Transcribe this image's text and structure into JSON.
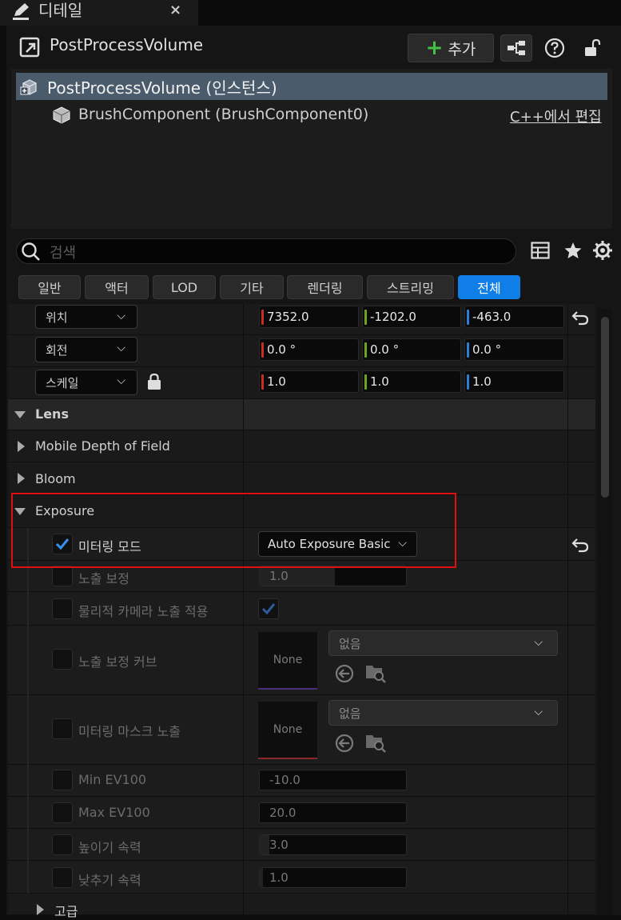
{
  "tab": {
    "title": "디테일",
    "close": "×"
  },
  "header": {
    "actor_name": "PostProcessVolume",
    "add_label": "추가"
  },
  "components": {
    "root": "PostProcessVolume (인스턴스)",
    "child": "BrushComponent (BrushComponent0)",
    "cpp_link": "C++에서 편집"
  },
  "search": {
    "placeholder": "검색"
  },
  "filters": [
    "일반",
    "액터",
    "LOD",
    "기타",
    "렌더링",
    "스트리밍",
    "전체"
  ],
  "transform": {
    "location": {
      "label": "위치",
      "x": "7352.0",
      "y": "-1202.0",
      "z": "-463.0"
    },
    "rotation": {
      "label": "회전",
      "x": "0.0 °",
      "y": "0.0 °",
      "z": "0.0 °"
    },
    "scale": {
      "label": "스케일",
      "x": "1.0",
      "y": "1.0",
      "z": "1.0"
    }
  },
  "sections": {
    "lens": "Lens",
    "mobile_dof": "Mobile Depth of Field",
    "bloom": "Bloom",
    "exposure": "Exposure",
    "advanced": "고급"
  },
  "exposure": {
    "metering_mode": {
      "label": "미터링 모드",
      "value": "Auto Exposure Basic"
    },
    "compensation": {
      "label": "노출 보정",
      "value": "1.0"
    },
    "physical_camera": {
      "label": "물리적 카메라 노출 적용"
    },
    "compensation_curve": {
      "label": "노출 보정 커브",
      "thumb": "None",
      "asset": "없음"
    },
    "metering_mask": {
      "label": "미터링 마스크 노출",
      "thumb": "None",
      "asset": "없음"
    },
    "min_ev": {
      "label": "Min EV100",
      "value": "-10.0"
    },
    "max_ev": {
      "label": "Max EV100",
      "value": "20.0"
    },
    "speed_up": {
      "label": "높이기 속력",
      "value": "3.0"
    },
    "speed_down": {
      "label": "낮추기 속력",
      "value": "1.0"
    }
  },
  "colors": {
    "accent": "#0f7ee6",
    "x_axis": "#c8301e",
    "y_axis": "#6fa51c",
    "z_axis": "#2b7fd6",
    "highlight": "#e10f0f"
  }
}
